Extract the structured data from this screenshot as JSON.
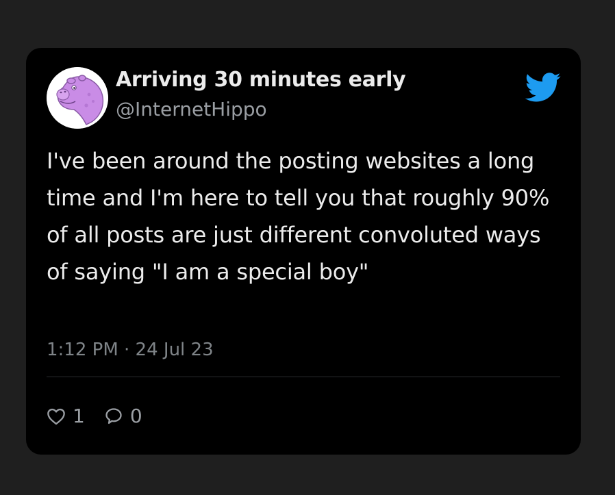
{
  "tweet": {
    "display_name": "Arriving 30 minutes early",
    "handle": "@InternetHippo",
    "text": "I've been around the posting websites a long time and I'm here to tell you that roughly 90% of all posts are just different convoluted ways of saying \"I am a special boy\"",
    "timestamp": "1:12 PM · 24 Jul 23"
  },
  "actions": {
    "like_count": "1",
    "reply_count": "0"
  },
  "icons": {
    "avatar": "hippo-avatar-icon",
    "brand": "twitter-bird-icon",
    "like": "heart-icon",
    "reply": "speech-bubble-icon"
  },
  "colors": {
    "page_background": "#1f1f1f",
    "card_background": "#000000",
    "brand_blue": "#1d9bf0",
    "avatar_purple": "#c98ce6",
    "text_primary": "#ececec",
    "text_secondary": "#9a9ea3"
  }
}
